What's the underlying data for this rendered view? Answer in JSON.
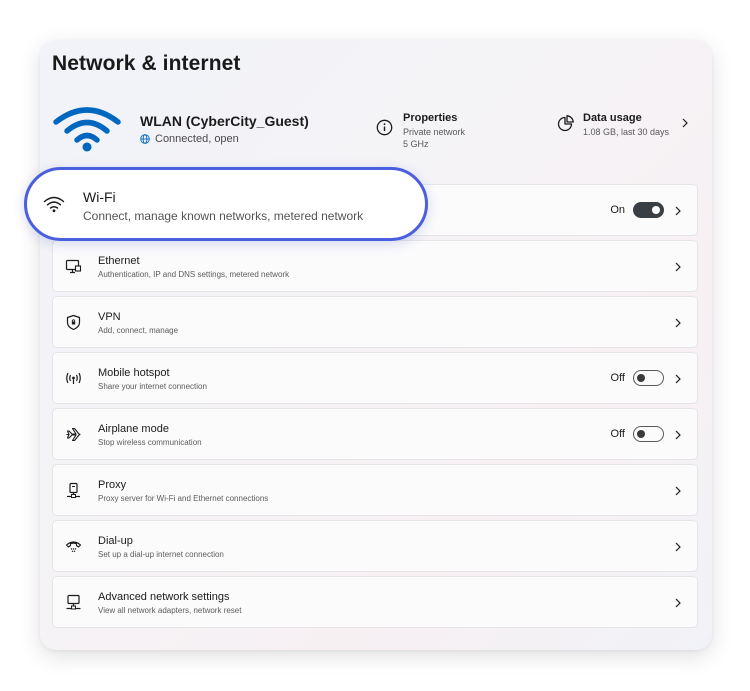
{
  "page": {
    "title": "Network & internet"
  },
  "header": {
    "network_name": "WLAN (CyberCity_Guest)",
    "connection_status": "Connected, open",
    "status_icon": "globe-icon",
    "properties": {
      "icon": "info-icon",
      "title": "Properties",
      "line1": "Private network",
      "line2": "5 GHz"
    },
    "data_usage": {
      "icon": "pie-chart-icon",
      "title": "Data usage",
      "detail": "1.08 GB, last 30 days"
    }
  },
  "wifi_callout": {
    "icon": "wifi-icon",
    "label": "Wi-Fi",
    "description": "Connect, manage known networks, metered network",
    "state": "On"
  },
  "rows": [
    {
      "icon": "ethernet-icon",
      "label": "Ethernet",
      "description": "Authentication, IP and DNS settings, metered network"
    },
    {
      "icon": "vpn-shield-icon",
      "label": "VPN",
      "description": "Add, connect, manage"
    },
    {
      "icon": "hotspot-icon",
      "label": "Mobile hotspot",
      "description": "Share your internet connection",
      "state": "Off"
    },
    {
      "icon": "airplane-icon",
      "label": "Airplane mode",
      "description": "Stop wireless communication",
      "state": "Off"
    },
    {
      "icon": "proxy-icon",
      "label": "Proxy",
      "description": "Proxy server for Wi-Fi and Ethernet connections"
    },
    {
      "icon": "dialup-icon",
      "label": "Dial-up",
      "description": "Set up a dial-up internet connection"
    },
    {
      "icon": "advanced-network-icon",
      "label": "Advanced network settings",
      "description": "View all network adapters, network reset"
    }
  ],
  "colors": {
    "accent": "#0067c0",
    "callout_border": "#4a5fe0",
    "toggle_on": "#3a3e45"
  }
}
